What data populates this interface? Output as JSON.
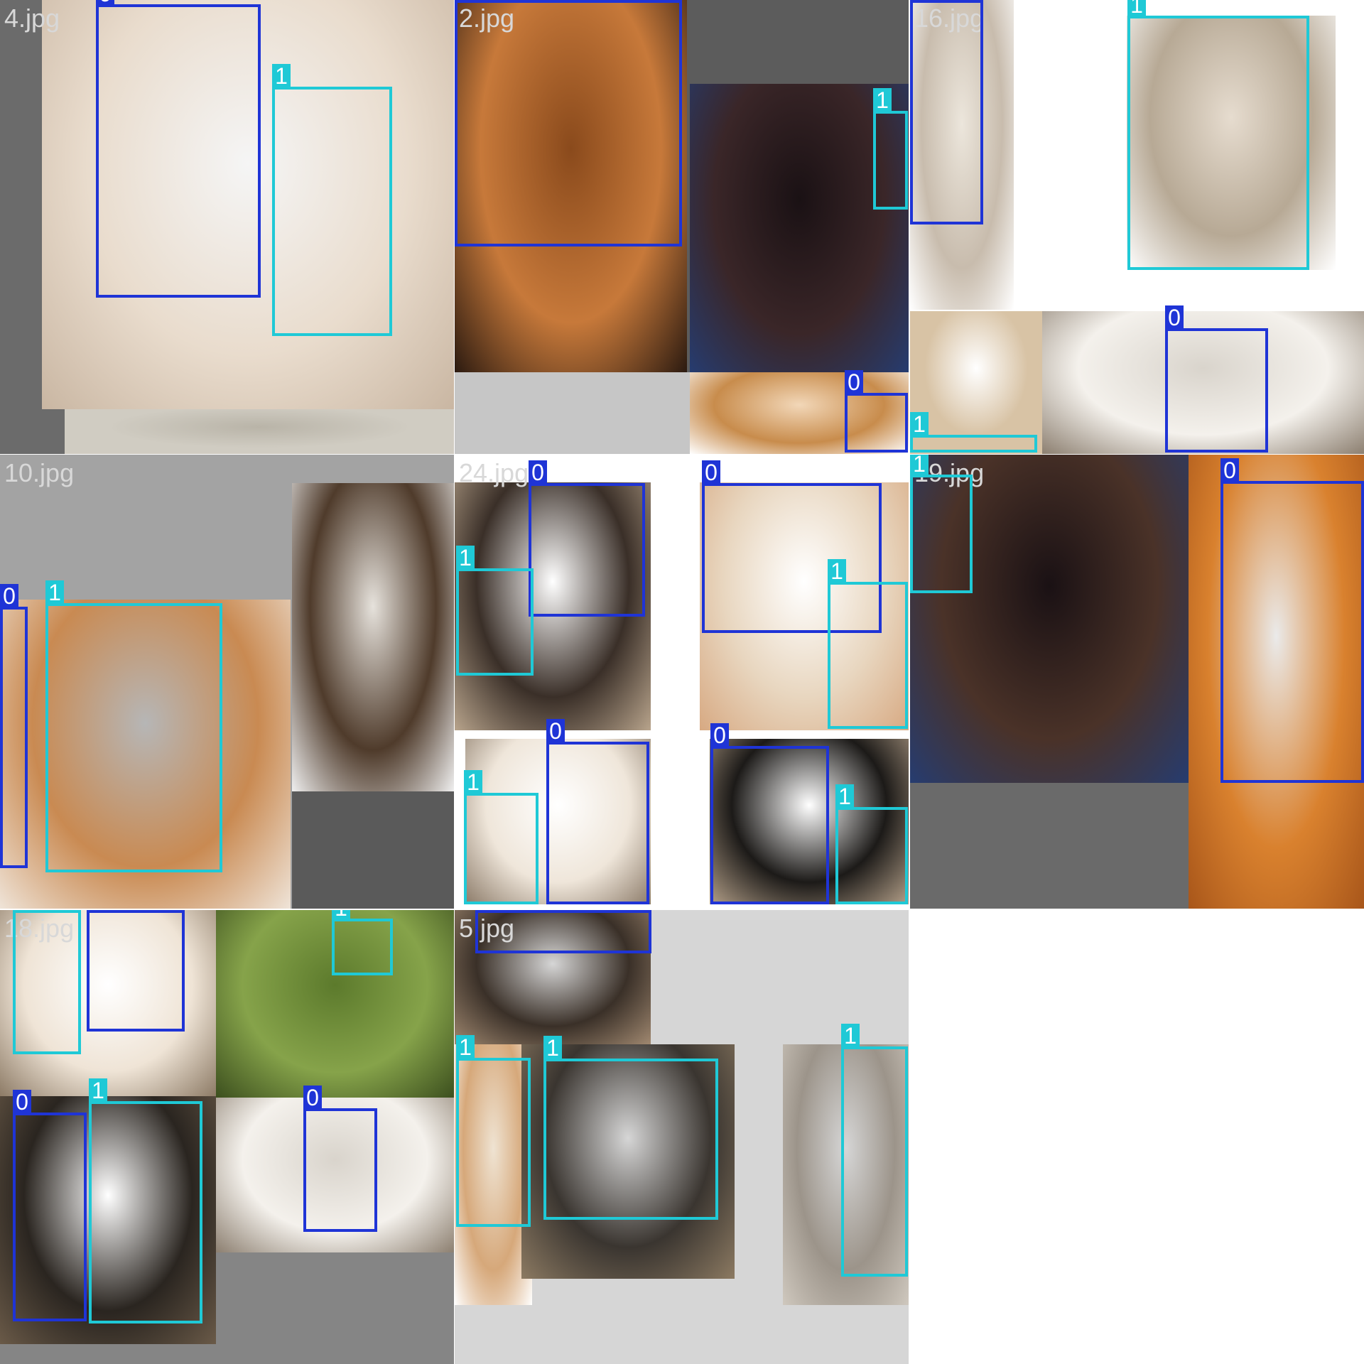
{
  "colors": {
    "class_0": "#1f34d6",
    "class_1": "#1fc9d6",
    "tile_label_text": "#d8d8d8",
    "gray_fill": "#5c5c5c"
  },
  "tiles": [
    {
      "name": "4.jpg",
      "regions": [
        {
          "kind": "solid",
          "color": "#6b6b6b"
        },
        {
          "kind": "photo",
          "subject": "dog and cat sitting together",
          "colors": [
            "#f5f5f5",
            "#e9dccd",
            "#c9b6a2"
          ]
        },
        {
          "kind": "photo",
          "subject": "stone pavement",
          "colors": [
            "#b9b4a8",
            "#d0ccc2"
          ]
        }
      ],
      "boxes": [
        {
          "label": "0"
        },
        {
          "label": "1"
        }
      ]
    },
    {
      "name": "2.jpg",
      "regions": [
        {
          "kind": "solid",
          "color": "#5c5c5c"
        },
        {
          "kind": "photo",
          "subject": "golden dog close-up",
          "colors": [
            "#8a4a1c",
            "#c7793a",
            "#2b1a10"
          ]
        },
        {
          "kind": "photo",
          "subject": "tabby cat on dark couch",
          "colors": [
            "#1a1114",
            "#3a2628",
            "#263c70"
          ]
        },
        {
          "kind": "solid",
          "color": "#c6c6c6"
        },
        {
          "kind": "photo",
          "subject": "dog and toy outdoors",
          "colors": [
            "#f2d7b8",
            "#c88c4c",
            "#ffffff"
          ]
        }
      ],
      "boxes": [
        {
          "label": "0"
        },
        {
          "label": "1"
        },
        {
          "label": "0"
        }
      ]
    },
    {
      "name": "16.jpg",
      "regions": [
        {
          "kind": "solid",
          "color": "#ffffff"
        },
        {
          "kind": "photo",
          "subject": "fluffy white dog",
          "colors": [
            "#ece6dc",
            "#c8bcad",
            "#ffffff"
          ]
        },
        {
          "kind": "photo",
          "subject": "tabby cat sitting",
          "colors": [
            "#e6dccf",
            "#b7a995",
            "#ffffff"
          ]
        },
        {
          "kind": "photo",
          "subject": "fluffy white toys",
          "colors": [
            "#d9d4cc",
            "#f4f1ec",
            "#8c7f70"
          ]
        },
        {
          "kind": "photo",
          "subject": "dog paw",
          "colors": [
            "#ffffff",
            "#d8c3a5"
          ]
        }
      ],
      "boxes": [
        {
          "label": "0"
        },
        {
          "label": "1"
        },
        {
          "label": "0"
        },
        {
          "label": "1"
        }
      ]
    },
    {
      "name": "10.jpg",
      "regions": [
        {
          "kind": "solid",
          "color": "#a3a3a3"
        },
        {
          "kind": "photo",
          "subject": "orange tabby kitten",
          "colors": [
            "#b6b6b6",
            "#c98a52",
            "#efe4d8"
          ]
        },
        {
          "kind": "photo",
          "subject": "fluffy plush close-up",
          "colors": [
            "#e6e2dc",
            "#4f3b2b",
            "#f0f0f0"
          ]
        },
        {
          "kind": "solid",
          "color": "#5a5a5a"
        }
      ],
      "boxes": [
        {
          "label": "0"
        },
        {
          "label": "1"
        }
      ]
    },
    {
      "name": "24.jpg",
      "regions": [
        {
          "kind": "solid",
          "color": "#ffffff"
        },
        {
          "kind": "photo",
          "subject": "tricolor dog with tabby cat",
          "colors": [
            "#ffffff",
            "#3a2f28",
            "#b8a48c"
          ]
        },
        {
          "kind": "photo",
          "subject": "cream puppy with kitten",
          "colors": [
            "#ffffff",
            "#e8d6bf",
            "#d7a982"
          ]
        },
        {
          "kind": "photo",
          "subject": "tabby cat and labrador",
          "colors": [
            "#ffffff",
            "#efe6da",
            "#8b7a68"
          ]
        },
        {
          "kind": "photo",
          "subject": "bernese puppy and kitten",
          "colors": [
            "#ffffff",
            "#1c1a18",
            "#b5a18a"
          ]
        }
      ],
      "boxes": [
        {
          "label": "0"
        },
        {
          "label": "1"
        },
        {
          "label": "0"
        },
        {
          "label": "1"
        },
        {
          "label": "0"
        },
        {
          "label": "1"
        },
        {
          "label": "0"
        },
        {
          "label": "1"
        }
      ]
    },
    {
      "name": "19.jpg",
      "regions": [
        {
          "kind": "solid",
          "color": "#6a6a6a"
        },
        {
          "kind": "photo",
          "subject": "tabby cat on dark couch",
          "colors": [
            "#1a1114",
            "#4a3228",
            "#263c70"
          ]
        },
        {
          "kind": "photo",
          "subject": "golden puppy close-up",
          "colors": [
            "#eaeaea",
            "#d9812e",
            "#a8561a"
          ]
        }
      ],
      "boxes": [
        {
          "label": "1"
        },
        {
          "label": "0"
        }
      ]
    },
    {
      "name": "18.jpg",
      "regions": [
        {
          "kind": "solid",
          "color": "#858585"
        },
        {
          "kind": "photo",
          "subject": "cat and dog",
          "colors": [
            "#ffffff",
            "#efe4d6",
            "#8d7b66"
          ]
        },
        {
          "kind": "photo",
          "subject": "cat and shoes on grass",
          "colors": [
            "#5c7a2c",
            "#86a34a",
            "#3c4f1e"
          ]
        },
        {
          "kind": "photo",
          "subject": "dark dog and tabby cat",
          "colors": [
            "#ffffff",
            "#2a2520",
            "#6a5a48"
          ]
        },
        {
          "kind": "photo",
          "subject": "fluffy white toys",
          "colors": [
            "#d9d4cc",
            "#f4f1ec",
            "#8c7f70"
          ]
        }
      ],
      "boxes": [
        {
          "label": "1"
        },
        {
          "label": "0"
        },
        {
          "label": "1"
        },
        {
          "label": "0"
        },
        {
          "label": "1"
        },
        {
          "label": "0"
        }
      ]
    },
    {
      "name": "5.jpg",
      "regions": [
        {
          "kind": "solid",
          "color": "#d6d6d6"
        },
        {
          "kind": "photo",
          "subject": "cat top edge",
          "colors": [
            "#d6d6d6",
            "#3a3028",
            "#a08870"
          ]
        },
        {
          "kind": "photo",
          "subject": "cream cat",
          "colors": [
            "#efe3d2",
            "#d6a87a",
            "#ffffff"
          ]
        },
        {
          "kind": "photo",
          "subject": "tabby cat face",
          "colors": [
            "#d6d6d6",
            "#3a3530",
            "#8c7a62"
          ]
        },
        {
          "kind": "photo",
          "subject": "gray kitten",
          "colors": [
            "#d6d6d6",
            "#9c948a",
            "#cfc8be"
          ]
        }
      ],
      "boxes": [
        {
          "label": "0"
        },
        {
          "label": "1"
        },
        {
          "label": "1"
        },
        {
          "label": "1"
        }
      ]
    }
  ]
}
